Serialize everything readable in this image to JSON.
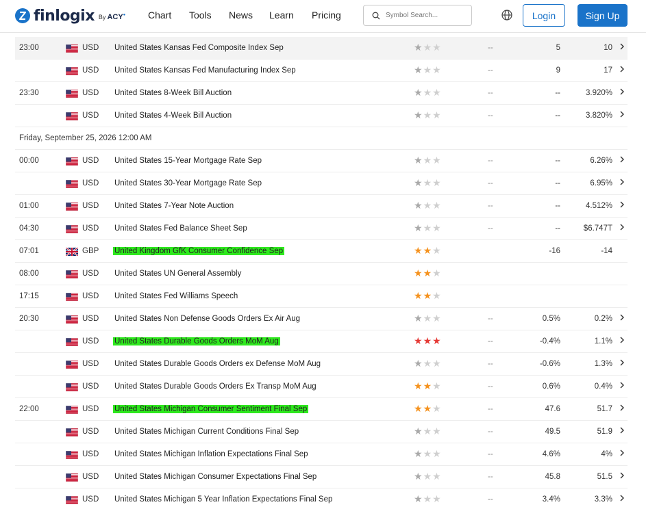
{
  "brand": {
    "name": "finlogix",
    "by": "By",
    "partner": "ACY",
    "partner_sup": "SECURITIES"
  },
  "nav": {
    "links": [
      "Chart",
      "Tools",
      "News",
      "Learn",
      "Pricing"
    ],
    "search_placeholder": "Symbol Search...",
    "login": "Login",
    "signup": "Sign Up"
  },
  "colors": {
    "accent": "#1a73c9",
    "highlight": "#2ee81d",
    "star_orange": "#f5921e",
    "star_red": "#e53935"
  },
  "events_before": [
    {
      "time": "23:00",
      "flag": "us",
      "currency": "USD",
      "event": "United States Kansas Fed Composite Index Sep",
      "importance": 1,
      "actual": "--",
      "forecast": "5",
      "previous": "10",
      "chevron": true,
      "highlighted_row": true,
      "marked": false
    },
    {
      "time": "",
      "flag": "us",
      "currency": "USD",
      "event": "United States Kansas Fed Manufacturing Index Sep",
      "importance": 1,
      "actual": "--",
      "forecast": "9",
      "previous": "17",
      "chevron": true,
      "marked": false
    },
    {
      "time": "23:30",
      "flag": "us",
      "currency": "USD",
      "event": "United States 8-Week Bill Auction",
      "importance": 1,
      "actual": "--",
      "forecast": "--",
      "previous": "3.920%",
      "chevron": true,
      "marked": false
    },
    {
      "time": "",
      "flag": "us",
      "currency": "USD",
      "event": "United States 4-Week Bill Auction",
      "importance": 1,
      "actual": "--",
      "forecast": "--",
      "previous": "3.820%",
      "chevron": true,
      "marked": false
    }
  ],
  "day_header": "Friday, September 25, 2026 12:00 AM",
  "events_after": [
    {
      "time": "00:00",
      "flag": "us",
      "currency": "USD",
      "event": "United States 15-Year Mortgage Rate Sep",
      "importance": 1,
      "actual": "--",
      "forecast": "--",
      "previous": "6.26%",
      "chevron": true,
      "marked": false
    },
    {
      "time": "",
      "flag": "us",
      "currency": "USD",
      "event": "United States 30-Year Mortgage Rate Sep",
      "importance": 1,
      "actual": "--",
      "forecast": "--",
      "previous": "6.95%",
      "chevron": true,
      "marked": false
    },
    {
      "time": "01:00",
      "flag": "us",
      "currency": "USD",
      "event": "United States 7-Year Note Auction",
      "importance": 1,
      "actual": "--",
      "forecast": "--",
      "previous": "4.512%",
      "chevron": true,
      "marked": false
    },
    {
      "time": "04:30",
      "flag": "us",
      "currency": "USD",
      "event": "United States Fed Balance Sheet Sep",
      "importance": 1,
      "actual": "--",
      "forecast": "--",
      "previous": "$6.747T",
      "chevron": true,
      "marked": false
    },
    {
      "time": "07:01",
      "flag": "gb",
      "currency": "GBP",
      "event": "United Kingdom GfK Consumer Confidence Sep",
      "importance": 2,
      "actual": "",
      "forecast": "-16",
      "previous": "-14",
      "chevron": false,
      "marked": true
    },
    {
      "time": "08:00",
      "flag": "us",
      "currency": "USD",
      "event": "United States UN General Assembly",
      "importance": 2,
      "actual": "",
      "forecast": "",
      "previous": "",
      "chevron": false,
      "marked": false
    },
    {
      "time": "17:15",
      "flag": "us",
      "currency": "USD",
      "event": "United States Fed Williams Speech",
      "importance": 2,
      "actual": "",
      "forecast": "",
      "previous": "",
      "chevron": false,
      "marked": false
    },
    {
      "time": "20:30",
      "flag": "us",
      "currency": "USD",
      "event": "United States Non Defense Goods Orders Ex Air Aug",
      "importance": 1,
      "actual": "--",
      "forecast": "0.5%",
      "previous": "0.2%",
      "chevron": true,
      "marked": false
    },
    {
      "time": "",
      "flag": "us",
      "currency": "USD",
      "event": "United States Durable Goods Orders MoM Aug",
      "importance": 3,
      "actual": "--",
      "forecast": "-0.4%",
      "previous": "1.1%",
      "chevron": true,
      "marked": true
    },
    {
      "time": "",
      "flag": "us",
      "currency": "USD",
      "event": "United States Durable Goods Orders ex Defense MoM Aug",
      "importance": 1,
      "actual": "--",
      "forecast": "-0.6%",
      "previous": "1.3%",
      "chevron": true,
      "marked": false
    },
    {
      "time": "",
      "flag": "us",
      "currency": "USD",
      "event": "United States Durable Goods Orders Ex Transp MoM Aug",
      "importance": 2,
      "actual": "--",
      "forecast": "0.6%",
      "previous": "0.4%",
      "chevron": true,
      "marked": false
    },
    {
      "time": "22:00",
      "flag": "us",
      "currency": "USD",
      "event": "United States Michigan Consumer Sentiment Final Sep",
      "importance": 2,
      "actual": "--",
      "forecast": "47.6",
      "previous": "51.7",
      "chevron": true,
      "marked": true
    },
    {
      "time": "",
      "flag": "us",
      "currency": "USD",
      "event": "United States Michigan Current Conditions Final Sep",
      "importance": 1,
      "actual": "--",
      "forecast": "49.5",
      "previous": "51.9",
      "chevron": true,
      "marked": false
    },
    {
      "time": "",
      "flag": "us",
      "currency": "USD",
      "event": "United States Michigan Inflation Expectations Final Sep",
      "importance": 1,
      "actual": "--",
      "forecast": "4.6%",
      "previous": "4%",
      "chevron": true,
      "marked": false
    },
    {
      "time": "",
      "flag": "us",
      "currency": "USD",
      "event": "United States Michigan Consumer Expectations Final Sep",
      "importance": 1,
      "actual": "--",
      "forecast": "45.8",
      "previous": "51.5",
      "chevron": true,
      "marked": false
    },
    {
      "time": "",
      "flag": "us",
      "currency": "USD",
      "event": "United States Michigan 5 Year Inflation Expectations Final Sep",
      "importance": 1,
      "actual": "--",
      "forecast": "3.4%",
      "previous": "3.3%",
      "chevron": true,
      "marked": false
    }
  ]
}
